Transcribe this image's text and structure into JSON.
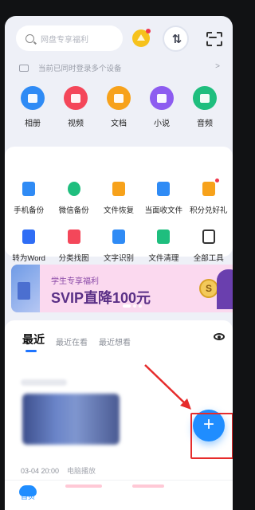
{
  "search": {
    "placeholder": "网盘专享福利"
  },
  "devices_notice": "当前已同时登录多个设备",
  "devices_arrow": ">",
  "transfer_glyph": "⇅",
  "media": [
    {
      "label": "相册",
      "color": "#2f8bf5",
      "icon": "photo-icon"
    },
    {
      "label": "视频",
      "color": "#f4475a",
      "icon": "video-icon"
    },
    {
      "label": "文档",
      "color": "#f7a21b",
      "icon": "document-icon"
    },
    {
      "label": "小说",
      "color": "#8d5cf0",
      "icon": "book-icon"
    },
    {
      "label": "音频",
      "color": "#1fbe7e",
      "icon": "music-icon"
    }
  ],
  "tools_row1": [
    {
      "label": "手机备份",
      "color": "#2f8bf5",
      "icon": "phone-backup-icon"
    },
    {
      "label": "微信备份",
      "color": "#1fbe7e",
      "icon": "wechat-icon"
    },
    {
      "label": "文件恢复",
      "color": "#f7a21b",
      "icon": "file-restore-icon"
    },
    {
      "label": "当面收文件",
      "color": "#2f8bf5",
      "icon": "receive-file-icon"
    },
    {
      "label": "积分兑好礼",
      "color": "#f7a21b",
      "icon": "gift-icon"
    }
  ],
  "tools_row2": [
    {
      "label": "转为Word",
      "color": "#2f6df5",
      "icon": "word-icon"
    },
    {
      "label": "分类找图",
      "color": "#f4475a",
      "icon": "image-search-icon"
    },
    {
      "label": "文字识别",
      "color": "#2f8bf5",
      "icon": "ocr-icon"
    },
    {
      "label": "文件清理",
      "color": "#1fbe7e",
      "icon": "cleanup-icon"
    },
    {
      "label": "全部工具",
      "color": "#333333",
      "icon": "all-tools-icon"
    }
  ],
  "banner": {
    "subtitle": "学生专享福利",
    "headline": "SVIP直降100元",
    "coin": "S"
  },
  "recent": {
    "tabs": [
      "最近",
      "最近在看",
      "最近想看"
    ],
    "item_meta": "03-04 20:00",
    "item_source": "电脑播放"
  },
  "fab_label": "+",
  "bottom_nav": {
    "home": "首页"
  }
}
